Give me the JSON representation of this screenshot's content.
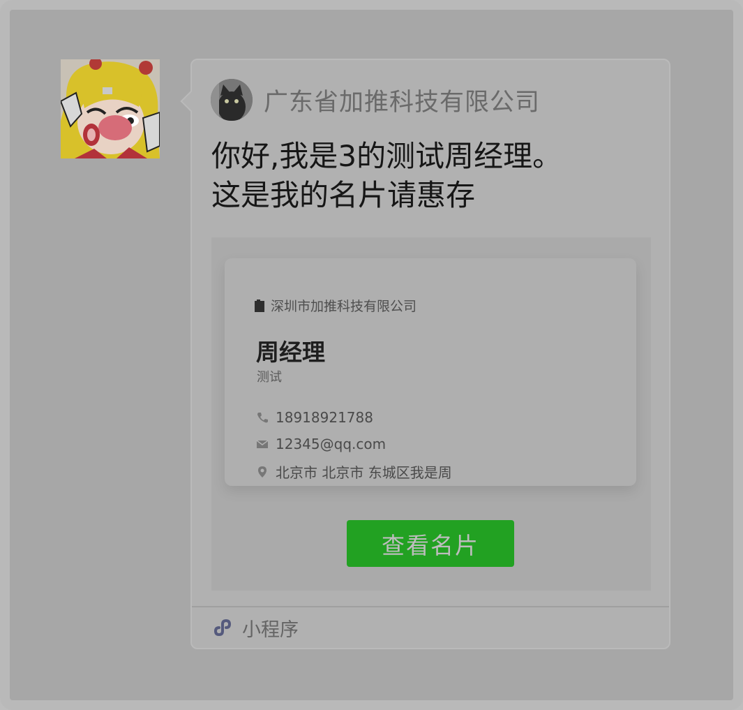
{
  "message": {
    "sender_company": "广东省加推科技有限公司",
    "text": "你好,我是3的测试周经理。\n这是我的名片请惠存"
  },
  "card": {
    "company": "深圳市加推科技有限公司",
    "name": "周经理",
    "title": "测试",
    "phone": "18918921788",
    "email": "12345@qq.com",
    "address": "北京市 北京市 东城区我是周"
  },
  "button": {
    "label": "查看名片"
  },
  "footer": {
    "label": "小程序"
  },
  "icons": {
    "building": "building-icon",
    "phone": "phone-icon",
    "email": "email-icon",
    "location": "location-pin-icon",
    "mini_program": "mini-program-icon"
  },
  "colors": {
    "button_bg": "#22a122",
    "button_text": "#bdbdbd",
    "message_text": "#161616",
    "company_text": "#6a6a6a"
  }
}
